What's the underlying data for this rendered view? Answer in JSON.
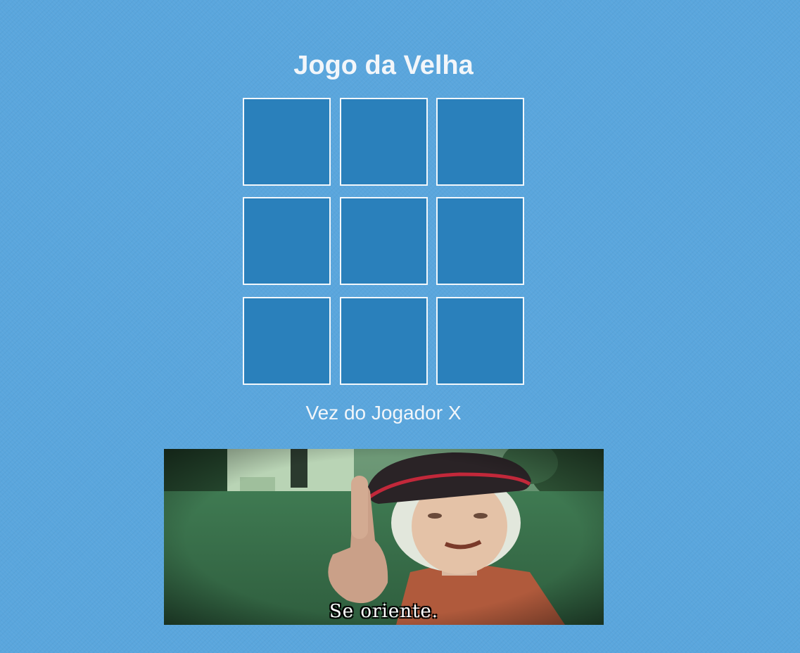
{
  "game": {
    "title": "Jogo da Velha",
    "status": "Vez do Jogador X",
    "current_player": "X"
  },
  "board": {
    "cells": [
      "",
      "",
      "",
      "",
      "",
      "",
      "",
      "",
      ""
    ]
  },
  "meme": {
    "caption": "Se oriente."
  },
  "colors": {
    "background": "#5aa6dd",
    "cell_fill": "#2a80bb",
    "cell_border": "#f2f7fb",
    "text": "#f2f6fa"
  }
}
